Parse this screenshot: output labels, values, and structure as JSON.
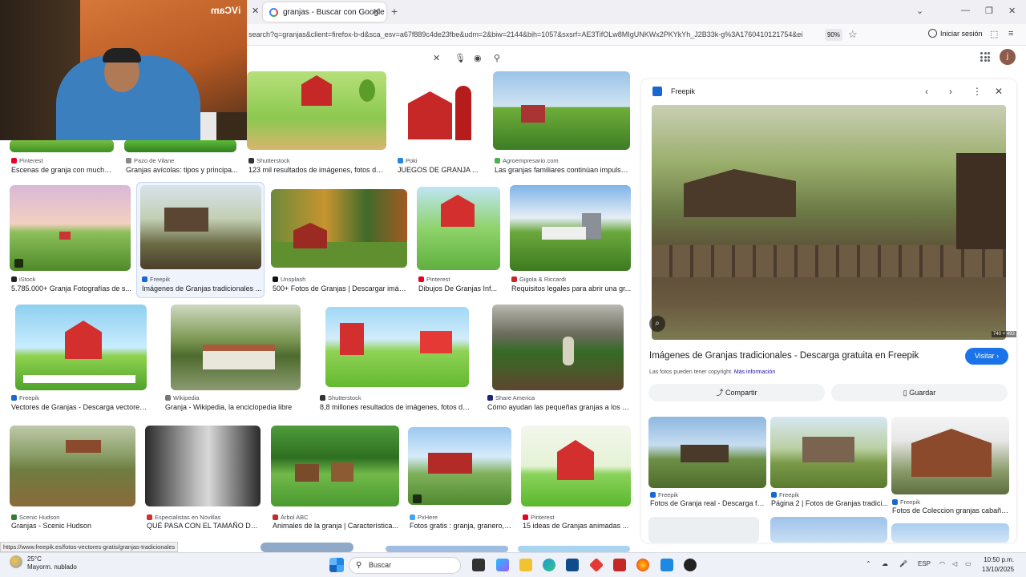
{
  "browser": {
    "tab_title": "granjas - Buscar con Google",
    "new_tab_icon": "+",
    "url": "search?q=granjas&client=firefox-b-d&sca_esv=a67f889c4de23fbe&udm=2&biw=2144&bih=1057&sxsrf=AE3TifOLw8MIgUNKWx2PKYkYh_J2B33k-g%3A1760410121754&ei",
    "zoom": "90%",
    "signin": "Iniciar sesión"
  },
  "google": {
    "avatar_letter": "j"
  },
  "webcam": {
    "label": "iVCam"
  },
  "results": [
    {
      "source": "Pinterest",
      "title": "Escenas de granja con mucho...",
      "color": "#e60023"
    },
    {
      "source": "Pazo de Vilane",
      "title": "Granjas avícolas: tipos y principa...",
      "color": "#888888"
    },
    {
      "source": "Shutterstock",
      "title": "123 mil resultados de imágenes, fotos de ...",
      "color": "#333333"
    },
    {
      "source": "Poki",
      "title": "JUEGOS DE GRANJA ...",
      "color": "#1e88e5"
    },
    {
      "source": "Agroempresario.com",
      "title": "Las granjas familiares continúan impulsa...",
      "color": "#4caf50"
    },
    {
      "source": "iStock",
      "title": "5.785.000+ Granja Fotografías de s...",
      "color": "#222222"
    },
    {
      "source": "Freepik",
      "title": "Imágenes de Granjas tradicionales ...",
      "color": "#1967d2"
    },
    {
      "source": "Unsplash",
      "title": "500+ Fotos de Granjas | Descargar imág...",
      "color": "#111111"
    },
    {
      "source": "Pinterest",
      "title": "Dibujos De Granjas Inf...",
      "color": "#e60023"
    },
    {
      "source": "Gigola & Riccardi",
      "title": "Requisitos legales para abrir una gr...",
      "color": "#c62828"
    },
    {
      "source": "Freepik",
      "title": "Vectores de Granjas - Descarga vectores g...",
      "color": "#1967d2"
    },
    {
      "source": "Wikipedia",
      "title": "Granja - Wikipedia, la enciclopedia libre",
      "color": "#777777"
    },
    {
      "source": "Shutterstock",
      "title": "8,8 millones resultados de imágenes, fotos de s...",
      "color": "#333333"
    },
    {
      "source": "Share America",
      "title": "Cómo ayudan las pequeñas granjas a los e...",
      "color": "#1a237e"
    },
    {
      "source": "Scenic Hudson",
      "title": "Granjas - Scenic Hudson",
      "color": "#2e7d32"
    },
    {
      "source": "Especialistas en Novillas",
      "title": "QUÉ PASA CON EL TAMAÑO DE...",
      "color": "#d32f2f"
    },
    {
      "source": "Árbol ABC",
      "title": "Animales de la granja | Característica...",
      "color": "#c62828"
    },
    {
      "source": "PxHere",
      "title": "Fotos gratis : granja, granero, ...",
      "color": "#42a5f5"
    },
    {
      "source": "Pinterest",
      "title": "15 ideas de Granjas animadas ...",
      "color": "#e60023"
    }
  ],
  "panel": {
    "site": "Freepik",
    "dims": "740 × 493",
    "title": "Imágenes de Granjas tradicionales - Descarga gratuita en Freepik",
    "visit": "Visitar",
    "note": "Las fotos pueden tener copyright.",
    "note_link": "Más información",
    "share": "Compartir",
    "save": "Guardar",
    "related": [
      {
        "source": "Freepik",
        "title": "Fotos de Granja real - Descarga fot..."
      },
      {
        "source": "Freepik",
        "title": "Página 2 | Fotos de Granjas tradici..."
      },
      {
        "source": "Freepik",
        "title": "Fotos de Coleccion granjas cabaña..."
      }
    ]
  },
  "status_url": "https://www.freepik.es/fotos-vectores-gratis/granjas-tradicionales",
  "taskbar": {
    "temp": "25°C",
    "weather": "Mayorm. nublado",
    "search": "Buscar",
    "lang": "ESP",
    "time": "10:50 p.m.",
    "date": "13/10/2025"
  }
}
